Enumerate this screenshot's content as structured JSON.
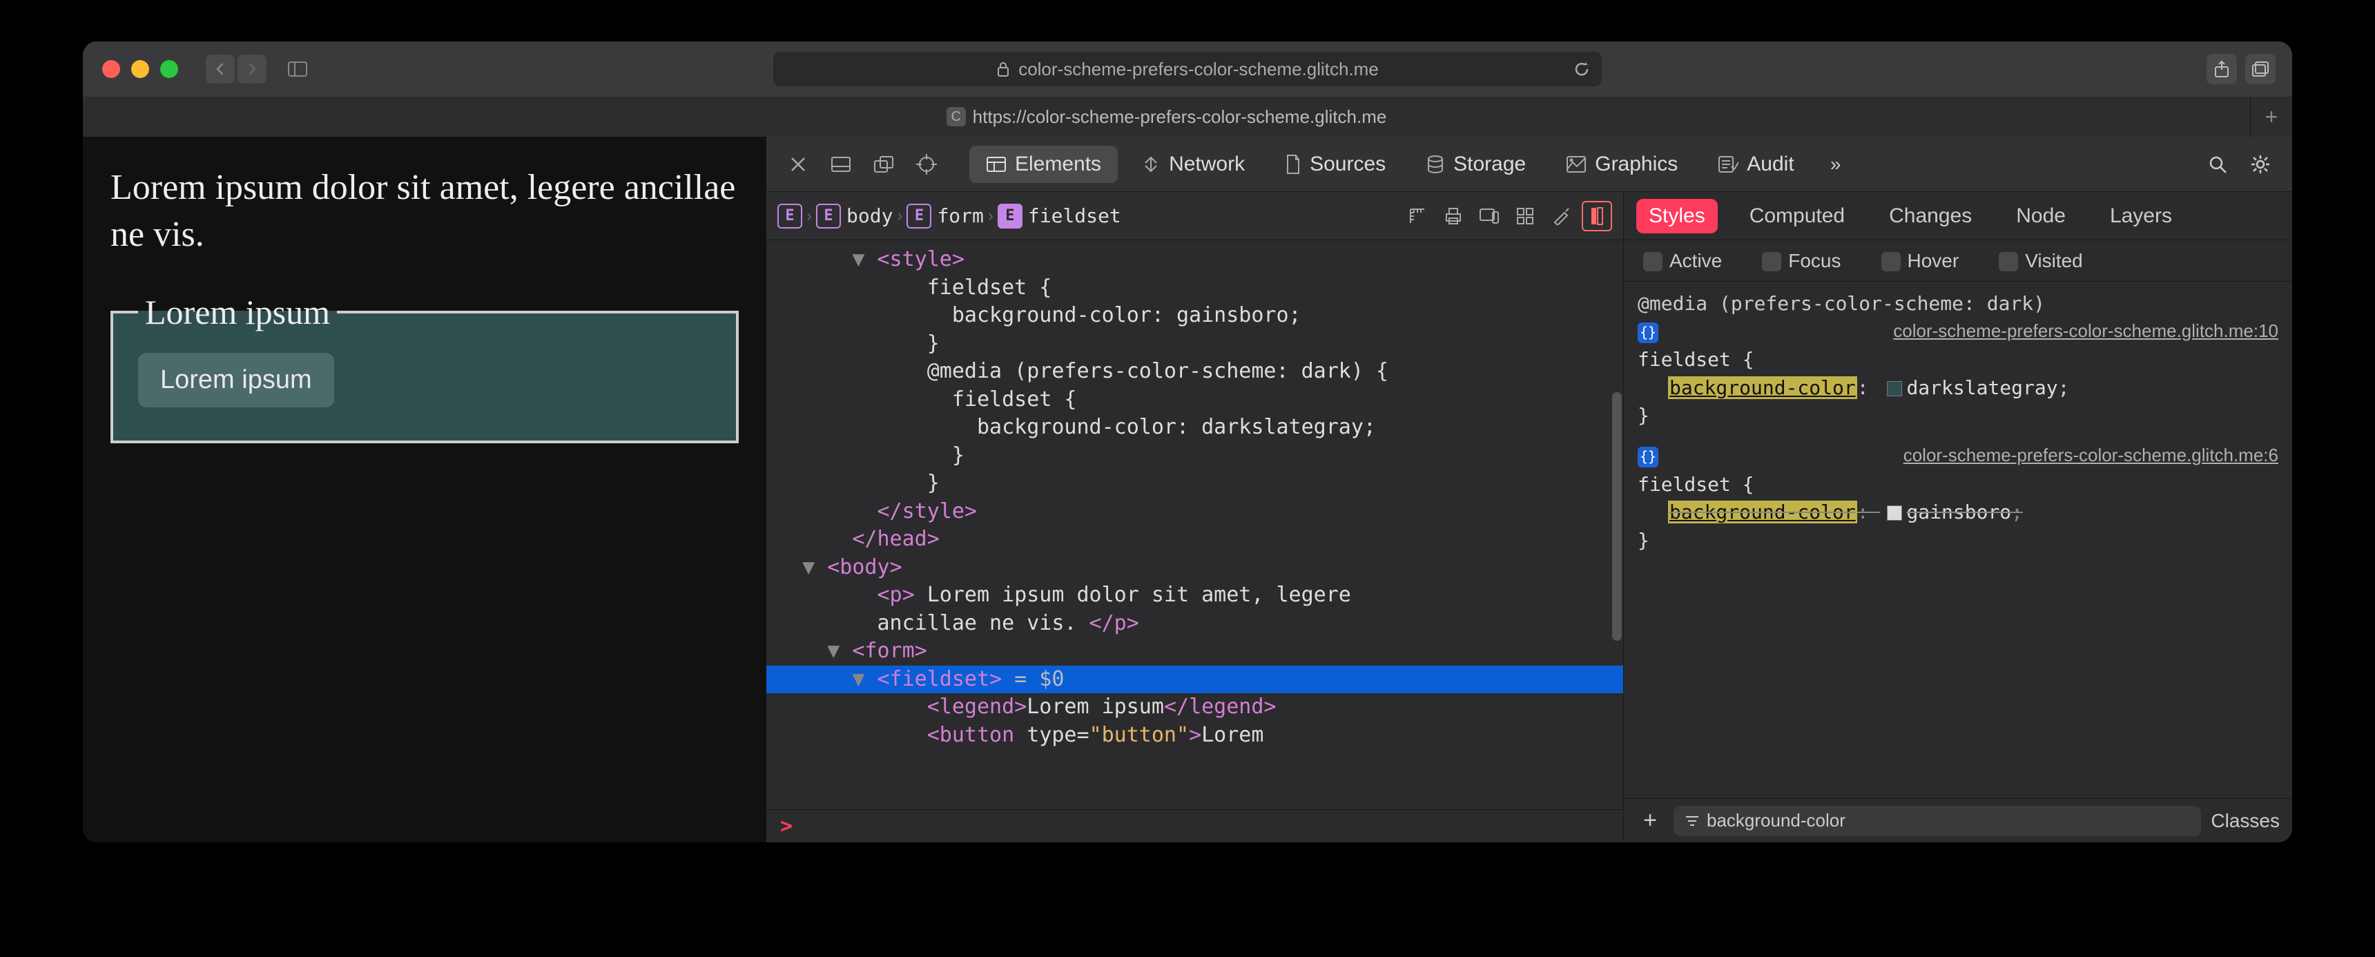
{
  "browser": {
    "url_display": "color-scheme-prefers-color-scheme.glitch.me",
    "lock_icon": "lock-icon",
    "tab": {
      "title": "https://color-scheme-prefers-color-scheme.glitch.me",
      "favicon_letter": "C"
    }
  },
  "page": {
    "paragraph": "Lorem ipsum dolor sit amet, legere ancillae ne vis.",
    "legend": "Lorem ipsum",
    "button": "Lorem ipsum"
  },
  "devtools": {
    "tabs": {
      "elements": "Elements",
      "network": "Network",
      "sources": "Sources",
      "storage": "Storage",
      "graphics": "Graphics",
      "audit": "Audit"
    },
    "overflow": "»",
    "breadcrumb": [
      "",
      "body",
      "form",
      "fieldset"
    ],
    "dom_lines": [
      {
        "indent": 3,
        "caret": "▼",
        "html": "<style>",
        "type": "tag"
      },
      {
        "indent": 5,
        "html": "fieldset {",
        "type": "txt"
      },
      {
        "indent": 6,
        "html": "background-color: gainsboro;",
        "type": "txt"
      },
      {
        "indent": 5,
        "html": "}",
        "type": "txt"
      },
      {
        "indent": 5,
        "html": "@media (prefers-color-scheme: dark) {",
        "type": "txt"
      },
      {
        "indent": 6,
        "html": "fieldset {",
        "type": "txt"
      },
      {
        "indent": 7,
        "html": "background-color: darkslategray;",
        "type": "txt"
      },
      {
        "indent": 6,
        "html": "}",
        "type": "txt"
      },
      {
        "indent": 5,
        "html": "}",
        "type": "txt"
      },
      {
        "indent": 3,
        "html": "</style>",
        "type": "tag"
      },
      {
        "indent": 2,
        "html": "</head>",
        "type": "tag"
      },
      {
        "indent": 1,
        "caret": "▼",
        "html": "<body>",
        "type": "tag"
      },
      {
        "indent": 3,
        "html_mixed": [
          [
            "tag",
            "<p>"
          ],
          [
            "txt",
            " Lorem ipsum dolor sit amet, legere"
          ]
        ]
      },
      {
        "indent": 3,
        "html_mixed": [
          [
            "txt",
            "ancillae ne vis. "
          ],
          [
            "tag",
            "</p>"
          ]
        ]
      },
      {
        "indent": 2,
        "caret": "▼",
        "html": "<form>",
        "type": "tag"
      },
      {
        "indent": 3,
        "caret": "▼",
        "selected": true,
        "html_mixed": [
          [
            "tag",
            "<fieldset>"
          ],
          [
            "eq0",
            " = $0"
          ]
        ]
      },
      {
        "indent": 5,
        "html_mixed": [
          [
            "tag",
            "<legend>"
          ],
          [
            "txt",
            "Lorem ipsum"
          ],
          [
            "tag",
            "</legend>"
          ]
        ]
      },
      {
        "indent": 5,
        "html_mixed": [
          [
            "tag",
            "<button "
          ],
          [
            "txt",
            "type="
          ],
          [
            "attr",
            "\"button\""
          ],
          [
            "tag",
            ">"
          ],
          [
            "txt",
            "Lorem"
          ]
        ]
      }
    ],
    "styles": {
      "tabs": {
        "styles": "Styles",
        "computed": "Computed",
        "changes": "Changes",
        "node": "Node",
        "layers": "Layers"
      },
      "pseudo": {
        "active": "Active",
        "focus": "Focus",
        "hover": "Hover",
        "visited": "Visited"
      },
      "rules": [
        {
          "media": "@media (prefers-color-scheme: dark)",
          "source": "color-scheme-prefers-color-scheme.glitch.me:10",
          "selector": "fieldset",
          "decls": [
            {
              "prop": "background-color",
              "value": "darkslategray",
              "swatch": "#2f4f4f",
              "overridden": false
            }
          ]
        },
        {
          "source": "color-scheme-prefers-color-scheme.glitch.me:6",
          "selector": "fieldset",
          "decls": [
            {
              "prop": "background-color",
              "value": "gainsboro",
              "swatch": "#dcdcdc",
              "overridden": true
            }
          ]
        }
      ],
      "filter_value": "background-color",
      "classes_label": "Classes"
    },
    "console_prompt": ">"
  }
}
